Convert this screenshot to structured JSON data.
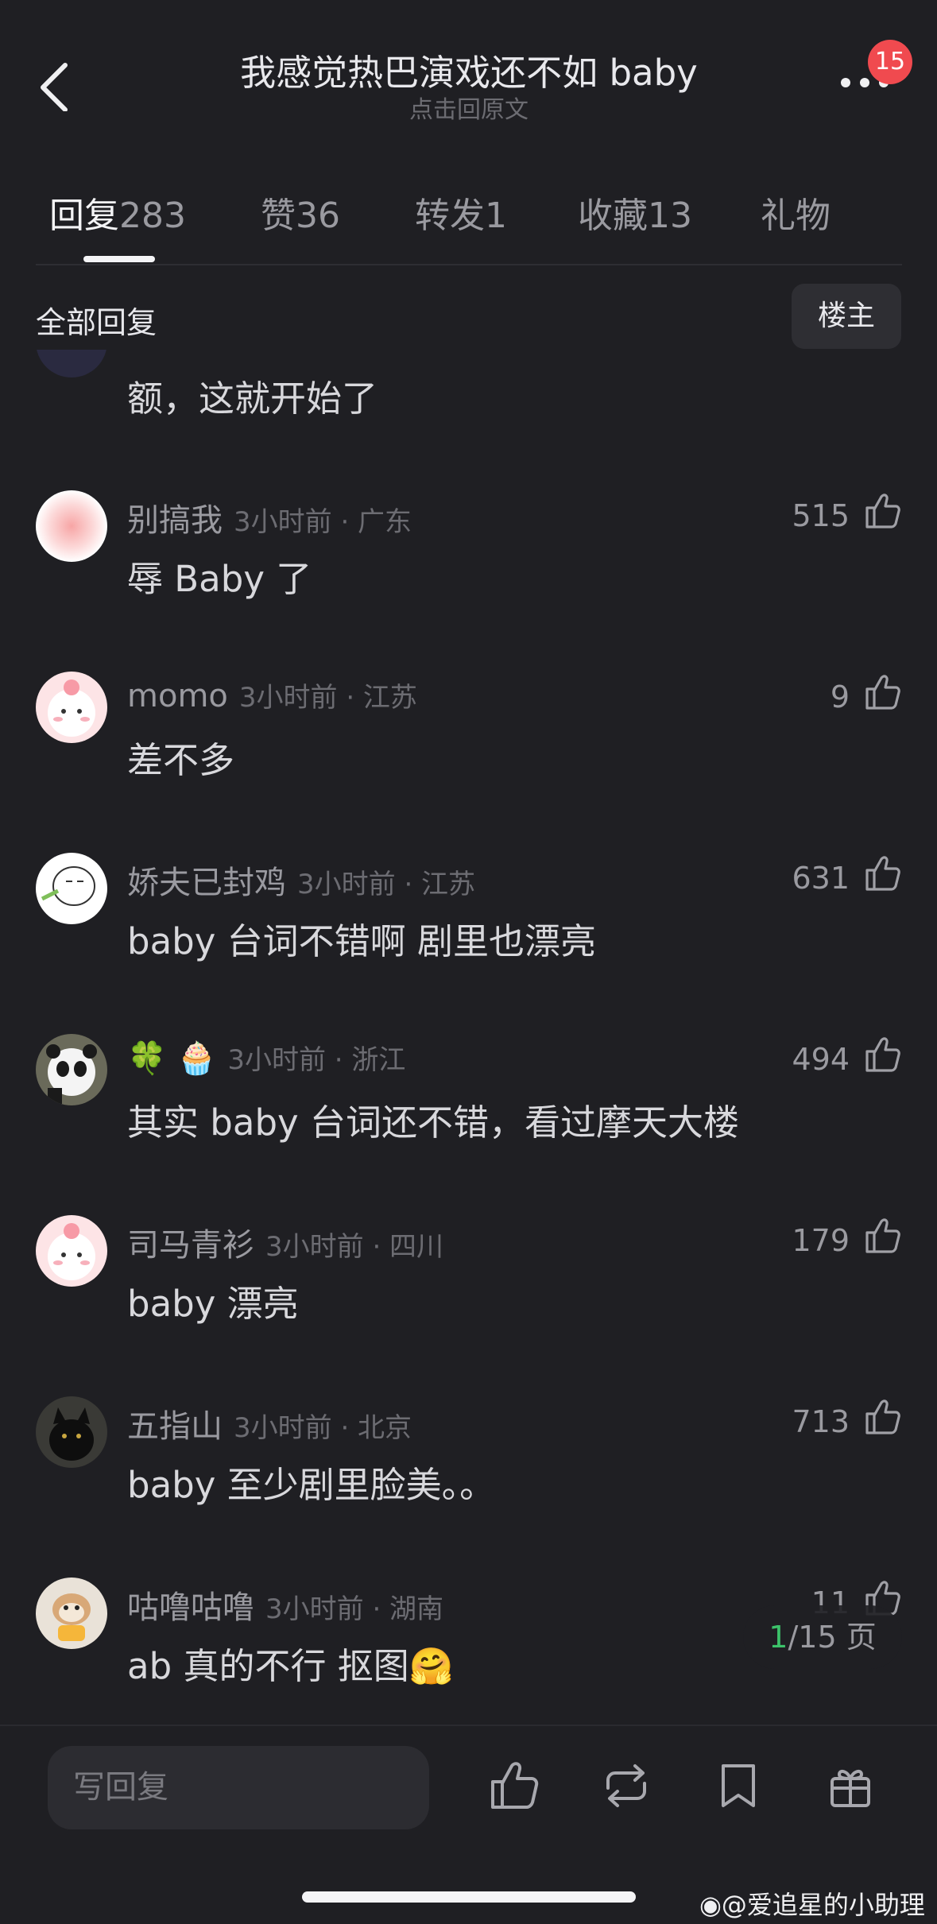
{
  "header": {
    "title": "我感觉热巴演戏还不如 baby",
    "subtitle": "点击回原文",
    "badge_count": "15"
  },
  "tabs": [
    {
      "name": "回复",
      "count": "283"
    },
    {
      "name": "赞",
      "count": "36"
    },
    {
      "name": "转发",
      "count": "1"
    },
    {
      "name": "收藏",
      "count": "13"
    },
    {
      "name": "礼物",
      "count": ""
    }
  ],
  "subheader": {
    "all_replies": "全部回复",
    "op_button": "楼主"
  },
  "partial_comment": {
    "text": "额，这就开始了"
  },
  "comments": [
    {
      "user": "别搞我",
      "time": "3小时前 · 广东",
      "text": "辱 Baby 了",
      "likes": "515"
    },
    {
      "user": "momo",
      "time": "3小时前 · 江苏",
      "text": "差不多",
      "likes": "9"
    },
    {
      "user": "娇夫已封鸡",
      "time": "3小时前 · 江苏",
      "text": "baby 台词不错啊 剧里也漂亮",
      "likes": "631"
    },
    {
      "user": "🍀 🧁",
      "time": "3小时前 · 浙江",
      "text": "其实 baby 台词还不错，看过摩天大楼",
      "likes": "494"
    },
    {
      "user": "司马青衫",
      "time": "3小时前 · 四川",
      "text": "baby 漂亮",
      "likes": "179"
    },
    {
      "user": "五指山",
      "time": "3小时前 · 北京",
      "text": "baby 至少剧里脸美。。",
      "likes": "713"
    },
    {
      "user": "咕噜咕噜",
      "time": "3小时前 · 湖南",
      "text": "ab 真的不行 抠图🤗",
      "likes": "11"
    }
  ],
  "page_indicator": {
    "current": "1",
    "rest": "/15 页"
  },
  "bottom_bar": {
    "reply_placeholder": "写回复"
  },
  "watermark": {
    "text": "@爱追星的小助理"
  },
  "icons": [
    "back-icon",
    "more-icon",
    "like-icon",
    "repost-icon",
    "bookmark-icon",
    "gift-icon",
    "weibo-icon"
  ]
}
